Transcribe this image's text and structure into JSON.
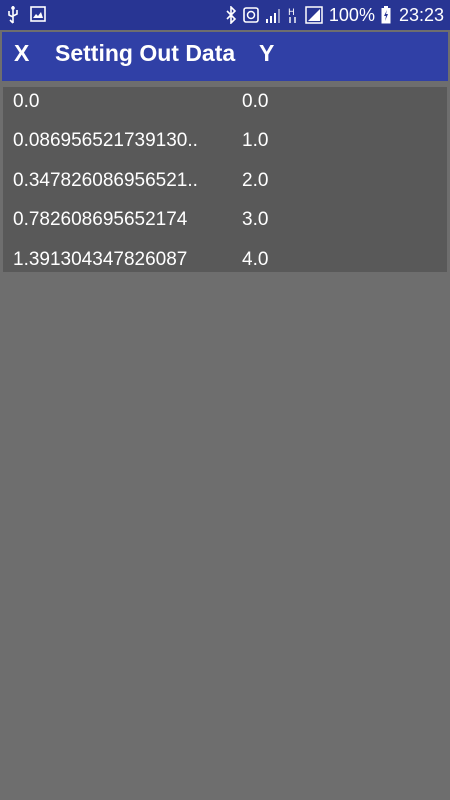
{
  "status_bar": {
    "left_icons": [
      "usb-icon",
      "image-icon"
    ],
    "right_icons": [
      "bluetooth-icon",
      "data-saver-icon",
      "signal-icon",
      "h-network-icon",
      "signal-full-icon",
      "battery-charging-icon"
    ],
    "battery": "100%",
    "time": "23:23"
  },
  "header": {
    "x_label": "X",
    "title": "Setting Out Data",
    "y_label": "Y"
  },
  "table": {
    "rows": [
      {
        "x": "0.0",
        "y": "0.0"
      },
      {
        "x": "0.086956521739130..",
        "y": "1.0"
      },
      {
        "x": "0.347826086956521..",
        "y": "2.0"
      },
      {
        "x": "0.782608695652174",
        "y": "3.0"
      },
      {
        "x": "1.391304347826087",
        "y": "4.0"
      }
    ]
  },
  "colors": {
    "status_bar": "#283593",
    "header": "#3040a6",
    "table_bg": "#595959",
    "page_bg": "#6e6e6e",
    "text": "#ffffff"
  }
}
